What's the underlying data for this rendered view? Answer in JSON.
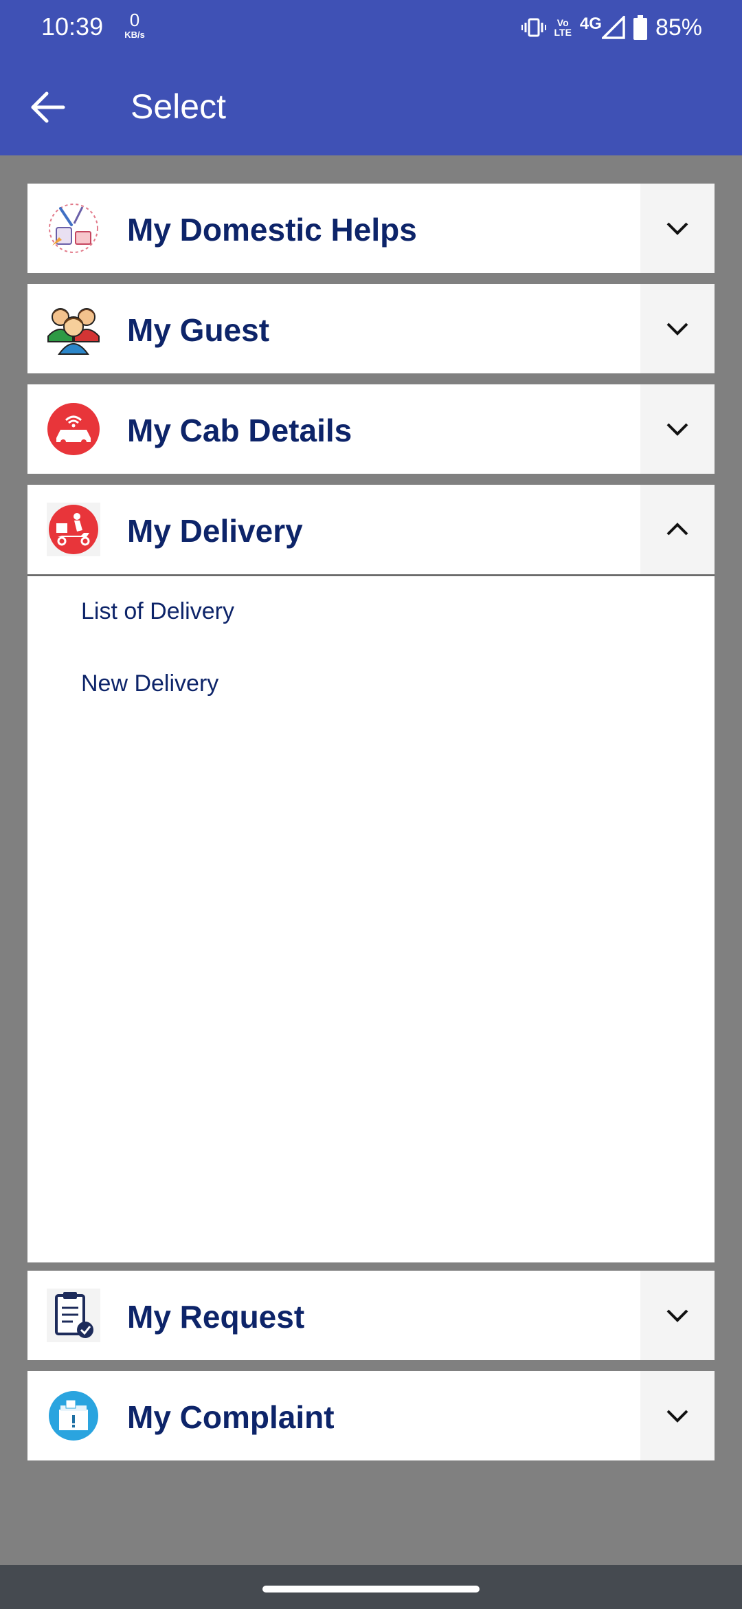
{
  "status_bar": {
    "time": "10:39",
    "net_speed_value": "0",
    "net_speed_unit": "KB/s",
    "volte_top": "Vo",
    "volte_bottom": "LTE",
    "network": "4G",
    "battery": "85%",
    "icons": [
      "vibrate-icon",
      "volte-icon",
      "signal-icon",
      "battery-icon"
    ]
  },
  "app_bar": {
    "title": "Select",
    "back_icon": "arrow-left-icon",
    "color": "#3F51B5"
  },
  "sections": [
    {
      "title": "My Domestic Helps",
      "icon": "domestic-helps-icon",
      "expanded": false
    },
    {
      "title": "My Guest",
      "icon": "guest-people-icon",
      "expanded": false
    },
    {
      "title": "My Cab Details",
      "icon": "cab-icon",
      "expanded": false
    },
    {
      "title": "My Delivery",
      "icon": "delivery-scooter-icon",
      "expanded": true,
      "items": [
        "List of Delivery",
        "New Delivery"
      ]
    },
    {
      "title": "My Request",
      "icon": "clipboard-check-icon",
      "expanded": false
    },
    {
      "title": "My Complaint",
      "icon": "complaint-box-icon",
      "expanded": false
    }
  ],
  "colors": {
    "title_text": "#0D2469",
    "background": "#808080",
    "panel": "#FFFFFF",
    "chevron_box": "#F4F4F4"
  }
}
